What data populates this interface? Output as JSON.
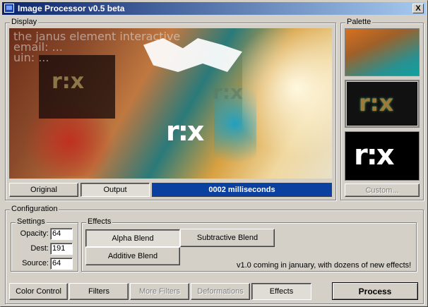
{
  "window": {
    "title": "Image Processor v0.5 beta",
    "close_label": "X",
    "icon": "app-monitor-icon"
  },
  "display": {
    "legend": "Display",
    "overlay_lines": [
      "the janus element interactive",
      "email: ...",
      "uin: ..."
    ],
    "logo_text": "r:x"
  },
  "view_buttons": {
    "original": "Original",
    "output": "Output"
  },
  "status": {
    "text": "0002 milliseconds"
  },
  "palette": {
    "legend": "Palette",
    "swatch_logo": "r:x",
    "custom_label": "Custom..."
  },
  "configuration": {
    "legend": "Configuration",
    "settings": {
      "legend": "Settings",
      "opacity_label": "Opacity:",
      "opacity_value": "64",
      "dest_label": "Dest:",
      "dest_value": "191",
      "source_label": "Source:",
      "source_value": "64"
    },
    "effects": {
      "legend": "Effects",
      "alpha_blend": "Alpha Blend",
      "subtractive_blend": "Subtractive Blend",
      "additive_blend": "Additive Blend",
      "note": "v1.0 coming in january, with dozens of new effects!"
    }
  },
  "tabs": {
    "color_control": "Color Control",
    "filters": "Filters",
    "more_filters": "More Filters",
    "deformations": "Deformations",
    "effects": "Effects",
    "process": "Process"
  },
  "colors": {
    "title_start": "#0a246a",
    "title_end": "#a6caf0",
    "status_bg": "#0a40a0",
    "face": "#d4d0c8"
  }
}
